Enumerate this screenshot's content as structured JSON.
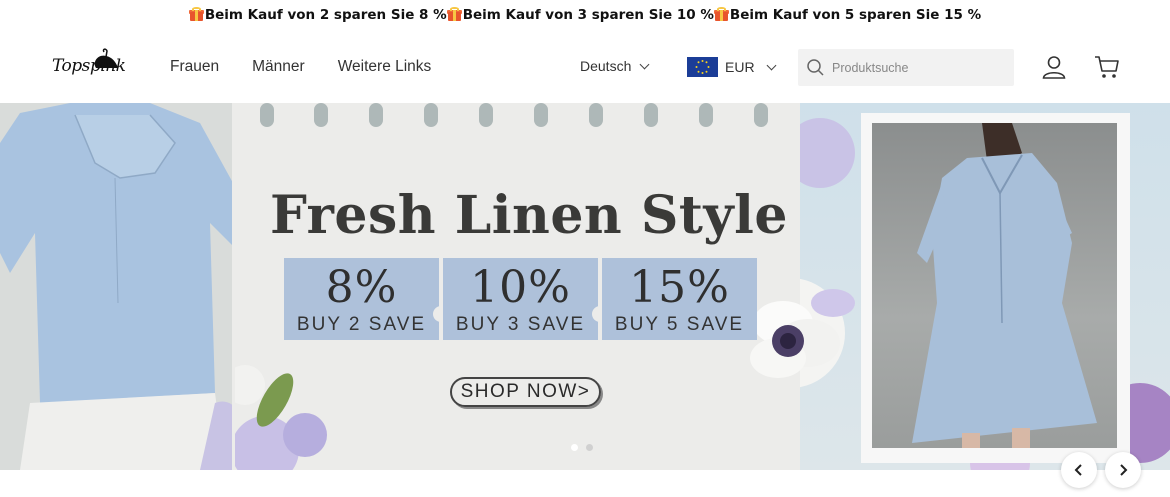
{
  "announcement": {
    "promos": [
      "Beim Kauf von 2 sparen Sie 8 %",
      "Beim Kauf von 3 sparen Sie 10 %",
      "Beim Kauf von 5 sparen Sie 15 %"
    ]
  },
  "header": {
    "logo_text": "Topspink",
    "nav": [
      "Frauen",
      "Männer",
      "Weitere Links"
    ],
    "language": "Deutsch",
    "currency": "EUR",
    "search_placeholder": "Produktsuche"
  },
  "hero": {
    "title": "Fresh Linen Style",
    "offers": [
      {
        "percent": "8%",
        "label": "BUY 2 SAVE"
      },
      {
        "percent": "10%",
        "label": "BUY 3 SAVE"
      },
      {
        "percent": "15%",
        "label": "BUY 5 SAVE"
      }
    ],
    "cta": "SHOP NOW>",
    "slides": 2,
    "active_slide": 1
  },
  "colors": {
    "offer_bg": "#aec1da",
    "shirt_blue": "#a9c3e0",
    "text_dark": "#3a3a38"
  }
}
